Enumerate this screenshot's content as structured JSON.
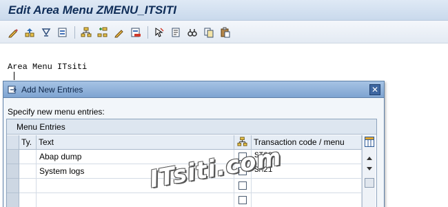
{
  "window": {
    "title": "Edit Area Menu ZMENU_ITSITI"
  },
  "toolbar": {
    "icons": [
      "pencil-icon",
      "move-up-icon",
      "move-down-icon",
      "open-icon",
      "hierarchy-icon",
      "add-node-icon",
      "edit-icon",
      "delete-icon",
      "cursor-select-icon",
      "details-icon",
      "find-icon",
      "copy-icon",
      "paste-icon"
    ]
  },
  "tree": {
    "root_label": "Area Menu ITsiti"
  },
  "dialog": {
    "title": "Add New Entries",
    "close_label": "✕",
    "instruction": "Specify new menu entries:",
    "table": {
      "caption": "Menu Entries",
      "headers": {
        "type": "Ty.",
        "text": "Text",
        "tcode": "Transaction code / menu"
      },
      "rows": [
        {
          "type": "",
          "text": "Abap dump",
          "checked": false,
          "tcode": "ST22"
        },
        {
          "type": "",
          "text": "System logs",
          "checked": false,
          "tcode": "SM21"
        },
        {
          "type": "",
          "text": "",
          "checked": false,
          "tcode": ""
        },
        {
          "type": "",
          "text": "",
          "checked": false,
          "tcode": ""
        }
      ]
    }
  },
  "watermark": {
    "text": "ITsiti.com"
  },
  "colors": {
    "title_text": "#0f2d58",
    "dialog_header": "#7ea4d1",
    "selector_cell": "#cdd7e3"
  }
}
